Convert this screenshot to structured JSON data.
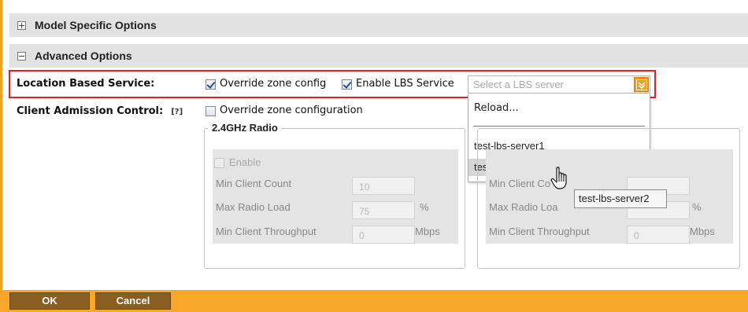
{
  "sections": {
    "model_specific": "Model Specific Options",
    "advanced": "Advanced Options"
  },
  "lbs": {
    "label": "Location Based Service:",
    "override_label": "Override zone config",
    "override_checked": true,
    "enable_label": "Enable LBS Service",
    "enable_checked": true,
    "select_placeholder": "Select a LBS server",
    "dropdown": {
      "reload": "Reload...",
      "items": [
        "test-lbs-server1",
        "test-lbs-server2"
      ],
      "hovered_item": "test-lbs-server2"
    },
    "tooltip": "test-lbs-server2"
  },
  "cac": {
    "label": "Client Admission Control:",
    "help": "[?]",
    "override_label": "Override zone configuration",
    "override_checked": false,
    "radio_24": {
      "legend": "2.4GHz Radio",
      "enable_label": "Enable",
      "min_client_count_label": "Min Client Count",
      "min_client_count_value": "10",
      "max_radio_load_label": "Max Radio Load",
      "max_radio_load_value": "75",
      "max_radio_load_unit": "%",
      "min_client_throughput_label": "Min Client Throughput",
      "min_client_throughput_value": "0",
      "min_client_throughput_unit": "Mbps"
    },
    "radio_5": {
      "min_client_count_label": "Min Client Co",
      "max_radio_load_label": "Max Radio Loa",
      "max_radio_load_unit": "%",
      "min_client_throughput_label": "Min Client Throughput",
      "min_client_throughput_value": "0",
      "min_client_throughput_unit": "Mbps"
    }
  },
  "footer": {
    "ok": "OK",
    "cancel": "Cancel"
  },
  "colors": {
    "accent": "#f9a72a",
    "button": "#8a5d23",
    "highlight": "#e31e24",
    "section_bar": "#e2e2e2"
  }
}
